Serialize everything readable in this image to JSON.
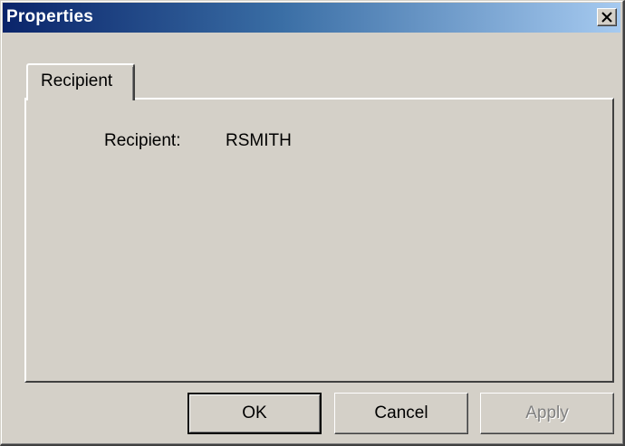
{
  "window": {
    "title": "Properties"
  },
  "titlebar": {
    "close_icon": "close-icon",
    "gradient_start": "#0a246a",
    "gradient_end": "#a6caf0"
  },
  "tabs": [
    {
      "label": "Recipient",
      "selected": true
    }
  ],
  "recipient_panel": {
    "recipient_label": "Recipient:",
    "recipient_value": "RSMITH"
  },
  "buttons": {
    "ok_label": "OK",
    "cancel_label": "Cancel",
    "apply_label": "Apply",
    "apply_enabled": false
  },
  "colors": {
    "face": "#d4d0c8",
    "disabled_text": "#808080"
  }
}
